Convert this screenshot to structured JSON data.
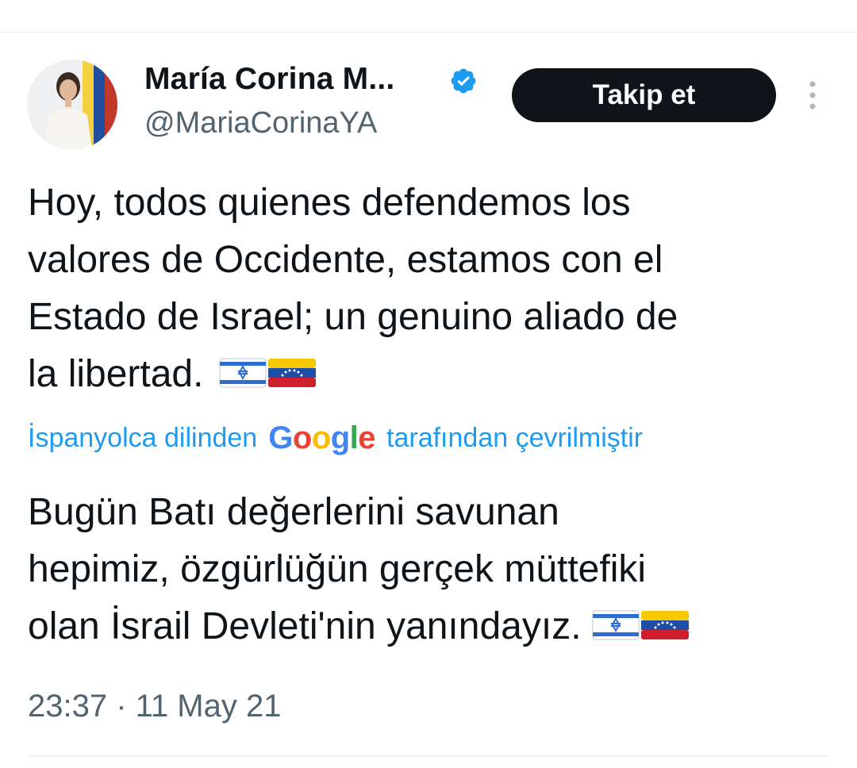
{
  "user": {
    "display_name": "María Corina M...",
    "handle": "@MariaCorinaYA",
    "verified": true,
    "verified_color": "#1d9bf0"
  },
  "follow_button": {
    "label": "Takip et"
  },
  "more_menu": {
    "icon": "more-vertical-icon"
  },
  "tweet": {
    "text": "Hoy, todos quienes defendemos los\nvalores de Occidente, estamos con el\nEstado de Israel; un genuino aliado de\nla libertad.",
    "emoji": [
      "israel-flag",
      "venezuela-flag"
    ],
    "translation": {
      "prefix": "İspanyolca dilinden",
      "provider": "Google",
      "suffix": "tarafından çevrilmiştir",
      "text": "Bugün Batı değerlerini savunan\nhepimiz, özgürlüğün gerçek müttefiki\nolan İsrail Devleti'nin yanındayız."
    },
    "timestamp": "23:37 · 11 May 21"
  },
  "colors": {
    "text": "#0f1419",
    "secondary": "#536471",
    "link": "#1d9bf0",
    "button_bg": "#0f1419",
    "button_text": "#ffffff"
  }
}
